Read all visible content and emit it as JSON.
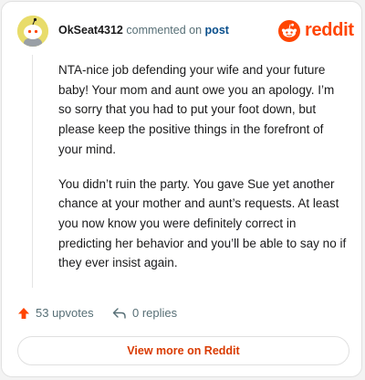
{
  "comment": {
    "username": "OkSeat4312",
    "action_text": "commented on",
    "post_link_label": "post",
    "paragraphs": [
      "NTA-nice job defending your wife and your future baby! Your mom and aunt owe you an apology. I’m so sorry that you had to put your foot down, but please keep the positive things in the forefront of your mind.",
      "You didn’t ruin the party. You gave Sue yet another chance at your mother and aunt’s requests. At least you now know you were definitely correct in predicting her behavior and you’ll be able to say no if they ever insist again."
    ]
  },
  "brand": {
    "name": "reddit",
    "icon": "reddit-logo-icon",
    "color": "#ff4500"
  },
  "actions": {
    "upvotes_label": "53 upvotes",
    "replies_label": "0 replies",
    "upvote_icon": "upvote-arrow-icon",
    "reply_icon": "reply-arrow-icon",
    "upvote_color": "#ff4500"
  },
  "footer": {
    "view_more_label": "View more on Reddit"
  }
}
